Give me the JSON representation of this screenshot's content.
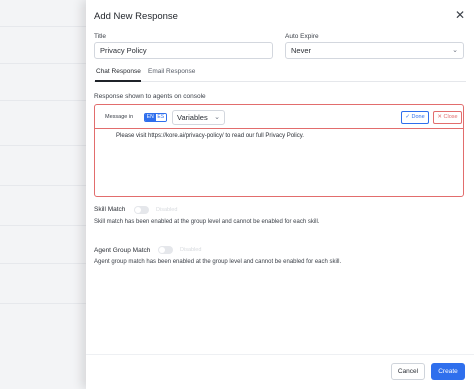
{
  "drawer": {
    "title": "Add New Response",
    "close_icon": "close-icon"
  },
  "form": {
    "title_label": "Title",
    "title_value": "Privacy Policy",
    "auto_expire_label": "Auto Expire",
    "auto_expire_value": "Never"
  },
  "tabs": [
    {
      "label": "Chat Response",
      "active": true
    },
    {
      "label": "Email Response",
      "active": false
    }
  ],
  "editor": {
    "section_label": "Response shown to agents on console",
    "message_in_label": "Message in",
    "languages": [
      "EN",
      "ES"
    ],
    "selected_language": "EN",
    "variables_label": "Variables",
    "done_label": "Done",
    "close_label": "Close",
    "content": "Please visit https://kore.ai/privacy-policy/ to read our full Privacy Policy."
  },
  "skill_match": {
    "title": "Skill Match",
    "toggle_label": "Disabled",
    "enabled": false,
    "description": "Skill match has been enabled at the group level and cannot be enabled for each skill."
  },
  "agent_group_match": {
    "title": "Agent Group Match",
    "toggle_label": "Disabled",
    "enabled": false,
    "description": "Agent group match has been enabled at the group level and cannot be enabled for each skill."
  },
  "footer": {
    "cancel_label": "Cancel",
    "create_label": "Create"
  },
  "colors": {
    "primary": "#2f6fed",
    "error": "#e26d6d"
  }
}
